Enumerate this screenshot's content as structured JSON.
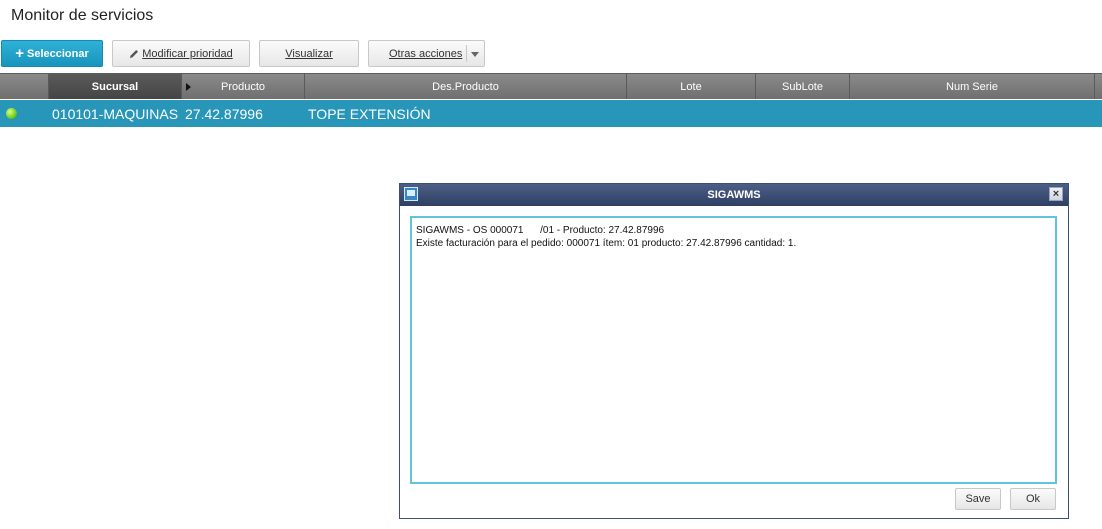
{
  "page": {
    "title": "Monitor de servicios"
  },
  "toolbar": {
    "select_label": "Seleccionar",
    "priority_label": "Modificar prioridad",
    "view_label": "Visualizar",
    "more_label": "Otras acciones"
  },
  "grid": {
    "columns": [
      "Sucursal",
      "Producto",
      "Des.Producto",
      "Lote",
      "SubLote",
      "Num Serie"
    ],
    "sorted_column": "Sucursal",
    "rows": [
      {
        "status": "green",
        "sucursal": "010101-MAQUINAS",
        "producto": "27.42.87996",
        "des_producto": "TOPE EXTENSIÓN",
        "lote": "",
        "sublote": "",
        "num_serie": ""
      }
    ]
  },
  "dialog": {
    "title": "SIGAWMS",
    "line1": "SIGAWMS - OS 000071      /01 - Producto: 27.42.87996",
    "line2": "Existe facturación para el pedido: 000071 ítem: 01 producto: 27.42.87996 cantidad: 1.",
    "save_label": "Save",
    "ok_label": "Ok",
    "close_symbol": "×"
  },
  "colors": {
    "accent": "#2796b8",
    "dialog_title": "#3a4a70",
    "status_ok": "#6fcf1f"
  }
}
